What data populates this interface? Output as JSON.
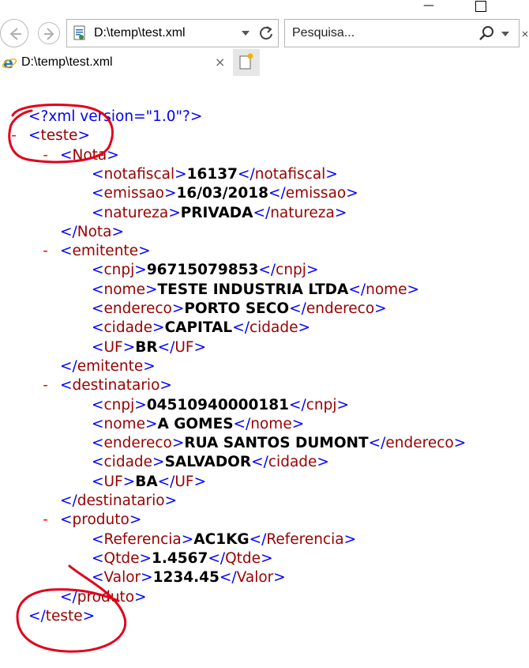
{
  "window": {
    "minimize_symbol": "—"
  },
  "address_bar": {
    "url": "D:\\temp\\test.xml"
  },
  "search_bar": {
    "placeholder": "Pesquisa..."
  },
  "tab": {
    "title": "D:\\temp\\test.xml",
    "close_symbol": "×"
  },
  "xml": {
    "declaration": "<?xml version=\"1.0\"?>",
    "collapse_marker": "-",
    "root": "teste",
    "nota": {
      "tag": "Nota",
      "fields": [
        {
          "tag": "notafiscal",
          "value": "16137"
        },
        {
          "tag": "emissao",
          "value": "16/03/2018"
        },
        {
          "tag": "natureza",
          "value": "PRIVADA"
        }
      ]
    },
    "emitente": {
      "tag": "emitente",
      "fields": [
        {
          "tag": "cnpj",
          "value": "96715079853"
        },
        {
          "tag": "nome",
          "value": "TESTE INDUSTRIA LTDA"
        },
        {
          "tag": "endereco",
          "value": "PORTO SECO"
        },
        {
          "tag": "cidade",
          "value": "CAPITAL"
        },
        {
          "tag": "UF",
          "value": "BR"
        }
      ]
    },
    "destinatario": {
      "tag": "destinatario",
      "fields": [
        {
          "tag": "cnpj",
          "value": "04510940000181"
        },
        {
          "tag": "nome",
          "value": "A GOMES"
        },
        {
          "tag": "endereco",
          "value": "RUA SANTOS DUMONT"
        },
        {
          "tag": "cidade",
          "value": "SALVADOR"
        },
        {
          "tag": "UF",
          "value": "BA"
        }
      ]
    },
    "produto": {
      "tag": "produto",
      "fields": [
        {
          "tag": "Referencia",
          "value": "AC1KG"
        },
        {
          "tag": "Qtde",
          "value": "1.4567"
        },
        {
          "tag": "Valor",
          "value": "1234.45"
        }
      ]
    }
  },
  "colors": {
    "bracket": "#0000ff",
    "tag_name": "#990000",
    "value": "#000000",
    "marker": "#ff0000",
    "annotation": "#e0001b"
  }
}
